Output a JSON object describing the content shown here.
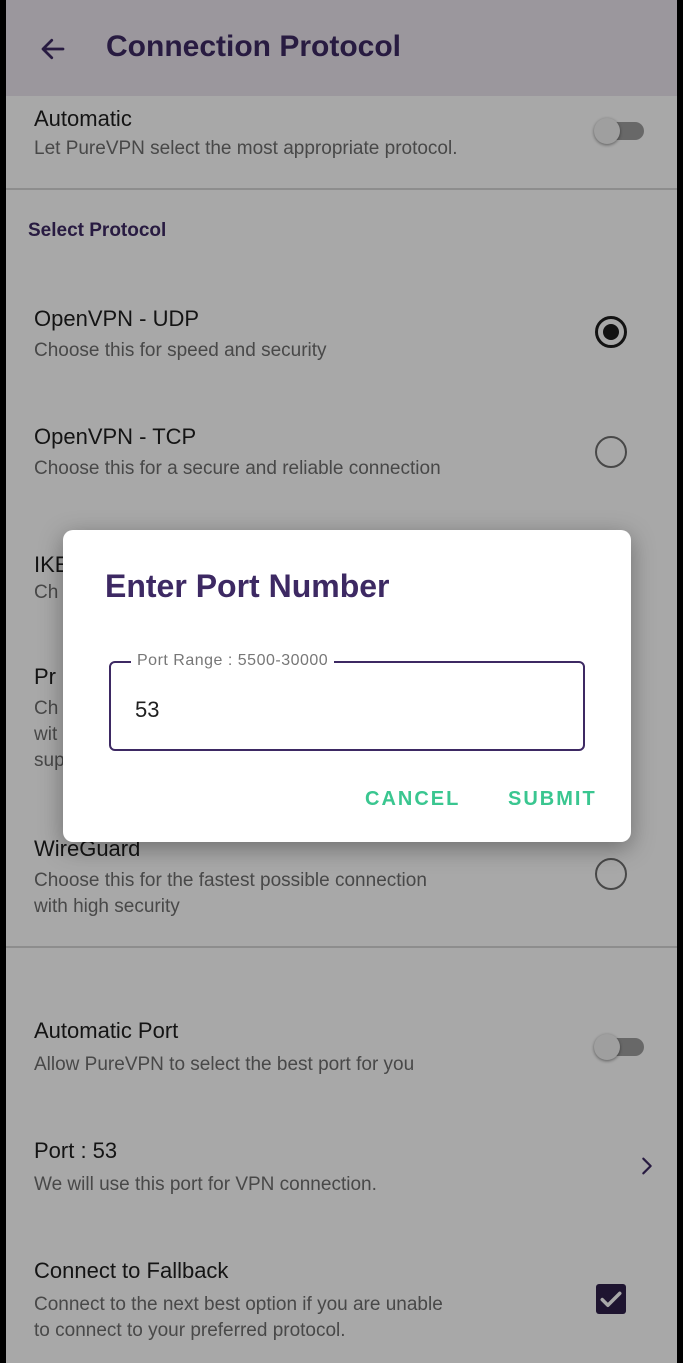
{
  "appbar": {
    "title": "Connection Protocol"
  },
  "automatic": {
    "title": "Automatic",
    "subtitle": "Let PureVPN select the most appropriate protocol.",
    "enabled": false
  },
  "section_header": "Select Protocol",
  "protocols": [
    {
      "title": "OpenVPN - UDP",
      "subtitle": "Choose this for speed and security",
      "selected": true
    },
    {
      "title": "OpenVPN - TCP",
      "subtitle": "Choose this for a secure and reliable connection",
      "selected": false
    },
    {
      "title": "IKE",
      "subtitle": "Ch",
      "selected": false
    },
    {
      "title": "Pr",
      "subtitle_lines": [
        "Ch",
        "wit",
        "sup"
      ],
      "selected": false
    },
    {
      "title": "WireGuard",
      "subtitle_lines": [
        "Choose this for the fastest possible connection",
        "with high security"
      ],
      "selected": false
    }
  ],
  "automatic_port": {
    "title": "Automatic Port",
    "subtitle": "Allow PureVPN to select the best port for you",
    "enabled": false
  },
  "port": {
    "title": "Port : 53",
    "subtitle": "We will use this port for VPN connection."
  },
  "fallback": {
    "title": "Connect to Fallback",
    "subtitle_lines": [
      "Connect to the next best option if you are unable",
      "to connect to your preferred protocol."
    ],
    "checked": true
  },
  "dialog": {
    "title": "Enter Port Number",
    "field_label": "Port Range :  5500-30000",
    "field_value": "53",
    "cancel_label": "CANCEL",
    "submit_label": "SUBMIT"
  },
  "colors": {
    "brand": "#3d2963",
    "accent": "#3ac690",
    "appbar_bg": "#ece6ef"
  },
  "icons": {
    "back": "arrow-left-icon",
    "chevron": "chevron-right-icon",
    "check": "check-icon"
  }
}
